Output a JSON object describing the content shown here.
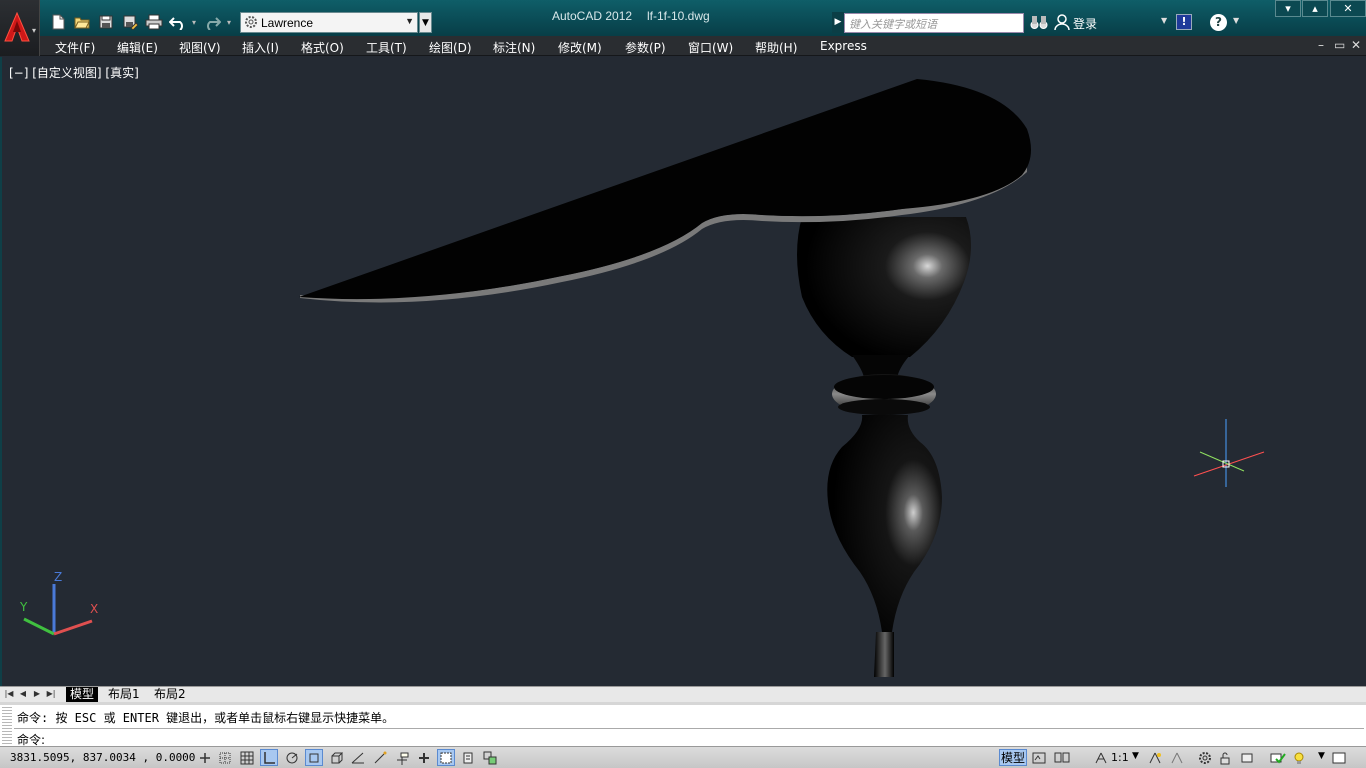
{
  "window": {
    "app_title": "AutoCAD 2012",
    "file_name": "lf-1f-10.dwg",
    "workspace": "Lawrence",
    "search_placeholder": "键入关键字或短语",
    "login_label": "登录",
    "exchange_label": "!",
    "help_label": "?",
    "buttons": {
      "minimize": "▾",
      "restore": "▴",
      "close": "✕"
    }
  },
  "quick_access": [
    {
      "name": "new-file-icon"
    },
    {
      "name": "open-file-icon"
    },
    {
      "name": "save-icon"
    },
    {
      "name": "save-as-icon"
    },
    {
      "name": "plot-icon"
    },
    {
      "name": "undo-icon"
    },
    {
      "name": "redo-icon"
    }
  ],
  "menu": {
    "items": [
      "文件(F)",
      "编辑(E)",
      "视图(V)",
      "插入(I)",
      "格式(O)",
      "工具(T)",
      "绘图(D)",
      "标注(N)",
      "修改(M)",
      "参数(P)",
      "窗口(W)",
      "帮助(H)",
      "Express"
    ],
    "doc_controls": [
      "–",
      "▭",
      "✕"
    ]
  },
  "viewport": {
    "label": "[−] [自定义视图] [真实]",
    "ucs": {
      "x": "X",
      "y": "Y",
      "z": "Z"
    }
  },
  "tabs": {
    "nav": [
      "|◀",
      "◀",
      "▶",
      "▶|"
    ],
    "items": [
      "模型",
      "布局1",
      "布局2"
    ]
  },
  "command": {
    "history": "命令:  按 ESC 或 ENTER 键退出，或者单击鼠标右键显示快捷菜单。",
    "prompt": "命令:"
  },
  "status": {
    "coordinates": "3831.5095, 837.0034 , 0.0000",
    "model_label": "模型",
    "scale": "1:1"
  },
  "colors": {
    "titlebar": "#0a4a54",
    "viewport_bg": "#242a33",
    "menubar": "#2a2d31"
  }
}
